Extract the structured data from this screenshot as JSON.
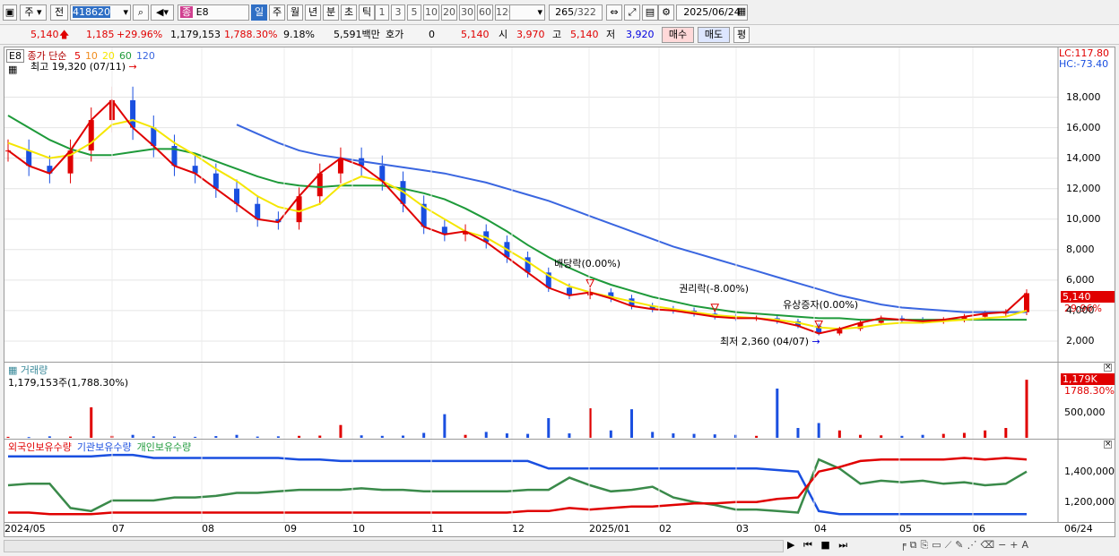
{
  "toolbar": {
    "type_label": "주",
    "prev_label": "전",
    "code_value": "418620",
    "product_code": "E8",
    "period_tabs": [
      "일",
      "주",
      "월",
      "년",
      "분",
      "초",
      "틱"
    ],
    "interval_buttons": [
      "1",
      "3",
      "5",
      "10",
      "20",
      "30",
      "60",
      "120"
    ],
    "count_value": "265",
    "count_total": "/322",
    "date_value": "2025/06/24"
  },
  "quote": {
    "price": "5,140",
    "change": "1,185",
    "change_pct": "+29.96%",
    "volume": "1,179,153",
    "volume_pct": "1,788.30%",
    "turnover": "9.18%",
    "amount": "5,591백만",
    "bid_label": "호가",
    "bid_value": "0",
    "bid_price": "5,140",
    "open_label": "시",
    "open": "3,970",
    "high_label": "고",
    "high": "5,140",
    "low_label": "저",
    "low": "3,920",
    "buy_label": "매수",
    "sell_label": "매도",
    "avg_label": "평"
  },
  "price_panel": {
    "code_tag": "E8",
    "legend_label": "종가 단순",
    "ma_labels": [
      "5",
      "10",
      "20",
      "60",
      "120"
    ],
    "max_label": "최고 19,320 (07/11)",
    "min_label": "최저 2,360 (04/07)",
    "lc_label": "LC:117.80",
    "hc_label": "HC:-73.40",
    "current_price_tag": "5,140",
    "current_pct_tag": "29.96%",
    "y_ticks": [
      "18,000",
      "16,000",
      "14,000",
      "12,000",
      "10,000",
      "8,000",
      "6,000",
      "4,000",
      "2,000"
    ],
    "events": [
      "배당락(0.00%)",
      "권리락(-8.00%)",
      "유상증자(0.00%)"
    ]
  },
  "volume_panel": {
    "title": "거래량",
    "value_label": "1,179,153주(1,788.30%)",
    "tag_value": "1,179K",
    "tag_pct": "1788.30%",
    "y_tick": "500,000"
  },
  "holding_panel": {
    "series_labels": [
      "외국인보유수량",
      "기관보유수량",
      "개인보유수량"
    ],
    "y_ticks": [
      "1,400,000",
      "1,200,000"
    ]
  },
  "x_axis": {
    "labels": [
      "2024/05",
      "07",
      "08",
      "09",
      "10",
      "11",
      "12",
      "2025/01",
      "02",
      "03",
      "04",
      "05",
      "06",
      "06/24"
    ]
  },
  "colors": {
    "up": "#e00000",
    "down": "#1a4fe0",
    "ma5": "#e00000",
    "ma10": "#f08c1e",
    "ma20": "#f5e600",
    "ma60": "#1e9a3a",
    "ma120": "#3a66e0"
  },
  "chart_data": {
    "type": "line",
    "title": "",
    "price_ylim": [
      1000,
      19500
    ],
    "months": [
      "2024/05",
      "07",
      "08",
      "09",
      "10",
      "11",
      "12",
      "2025/01",
      "02",
      "03",
      "04",
      "05",
      "06",
      "06/24"
    ],
    "close": [
      14500,
      13500,
      13000,
      14500,
      16500,
      17800,
      16000,
      14800,
      13500,
      13000,
      12000,
      11000,
      10000,
      9800,
      11500,
      13000,
      14000,
      13500,
      12500,
      11000,
      9500,
      9000,
      9200,
      8500,
      7500,
      6500,
      5500,
      5000,
      5200,
      4800,
      4300,
      4100,
      4000,
      3800,
      3600,
      3500,
      3500,
      3300,
      3000,
      2500,
      2800,
      3200,
      3500,
      3400,
      3300,
      3400,
      3600,
      3800,
      3900,
      5140
    ],
    "ma20": [
      15000,
      14500,
      14000,
      14200,
      15000,
      16200,
      16500,
      16000,
      15000,
      14200,
      13300,
      12500,
      11500,
      10800,
      10500,
      11000,
      12200,
      12800,
      12500,
      11800,
      10800,
      10000,
      9200,
      8800,
      8000,
      7200,
      6300,
      5600,
      5200,
      4900,
      4600,
      4300,
      4100,
      3900,
      3700,
      3600,
      3500,
      3400,
      3200,
      2900,
      2800,
      2900,
      3100,
      3200,
      3200,
      3300,
      3400,
      3500,
      3600,
      4000
    ],
    "ma60": [
      16800,
      16000,
      15200,
      14600,
      14200,
      14200,
      14400,
      14600,
      14600,
      14300,
      13800,
      13300,
      12800,
      12400,
      12200,
      12100,
      12200,
      12200,
      12200,
      12000,
      11700,
      11300,
      10700,
      10000,
      9200,
      8300,
      7500,
      6800,
      6200,
      5700,
      5300,
      4900,
      4600,
      4300,
      4100,
      3900,
      3800,
      3700,
      3600,
      3500,
      3500,
      3400,
      3400,
      3400,
      3400,
      3400,
      3400,
      3400,
      3400,
      3400
    ],
    "ma120": [
      null,
      null,
      null,
      null,
      null,
      null,
      null,
      null,
      null,
      null,
      null,
      16200,
      15600,
      15000,
      14500,
      14200,
      14000,
      13800,
      13600,
      13400,
      13200,
      13000,
      12700,
      12400,
      12000,
      11600,
      11200,
      10700,
      10200,
      9700,
      9200,
      8700,
      8200,
      7800,
      7400,
      7000,
      6600,
      6200,
      5800,
      5400,
      5000,
      4700,
      4400,
      4200,
      4100,
      4000,
      3900,
      3900,
      3900,
      3900
    ],
    "volume": [
      20000,
      15000,
      30000,
      25000,
      620000,
      40000,
      60000,
      30000,
      25000,
      20000,
      35000,
      60000,
      25000,
      30000,
      40000,
      45000,
      260000,
      50000,
      40000,
      45000,
      100000,
      480000,
      60000,
      120000,
      90000,
      80000,
      400000,
      90000,
      600000,
      150000,
      580000,
      120000,
      90000,
      80000,
      70000,
      60000,
      40000,
      1000000,
      200000,
      300000,
      150000,
      60000,
      50000,
      40000,
      60000,
      80000,
      100000,
      150000,
      200000,
      1179153
    ],
    "foreign_holding": [
      1150000,
      1150000,
      1140000,
      1140000,
      1140000,
      1150000,
      1150000,
      1150000,
      1150000,
      1150000,
      1150000,
      1150000,
      1150000,
      1150000,
      1150000,
      1150000,
      1150000,
      1150000,
      1150000,
      1150000,
      1150000,
      1150000,
      1150000,
      1150000,
      1150000,
      1160000,
      1160000,
      1180000,
      1170000,
      1180000,
      1190000,
      1190000,
      1200000,
      1210000,
      1210000,
      1220000,
      1220000,
      1240000,
      1250000,
      1420000,
      1450000,
      1490000,
      1500000,
      1500000,
      1500000,
      1500000,
      1510000,
      1500000,
      1510000,
      1500000
    ],
    "institution_holding": [
      1520000,
      1520000,
      1520000,
      1520000,
      1520000,
      1530000,
      1530000,
      1510000,
      1510000,
      1510000,
      1510000,
      1510000,
      1510000,
      1510000,
      1500000,
      1500000,
      1490000,
      1490000,
      1490000,
      1490000,
      1490000,
      1490000,
      1490000,
      1490000,
      1490000,
      1490000,
      1440000,
      1440000,
      1440000,
      1440000,
      1440000,
      1440000,
      1440000,
      1440000,
      1440000,
      1440000,
      1440000,
      1430000,
      1420000,
      1160000,
      1140000,
      1140000,
      1140000,
      1140000,
      1140000,
      1140000,
      1140000,
      1140000,
      1140000,
      1140000
    ],
    "individual_holding": [
      1330000,
      1340000,
      1340000,
      1180000,
      1160000,
      1230000,
      1230000,
      1230000,
      1250000,
      1250000,
      1260000,
      1280000,
      1280000,
      1290000,
      1300000,
      1300000,
      1300000,
      1310000,
      1300000,
      1300000,
      1290000,
      1290000,
      1290000,
      1290000,
      1290000,
      1300000,
      1300000,
      1380000,
      1330000,
      1290000,
      1300000,
      1320000,
      1250000,
      1220000,
      1200000,
      1170000,
      1170000,
      1160000,
      1150000,
      1500000,
      1440000,
      1340000,
      1360000,
      1350000,
      1360000,
      1340000,
      1350000,
      1330000,
      1340000,
      1420000
    ]
  }
}
